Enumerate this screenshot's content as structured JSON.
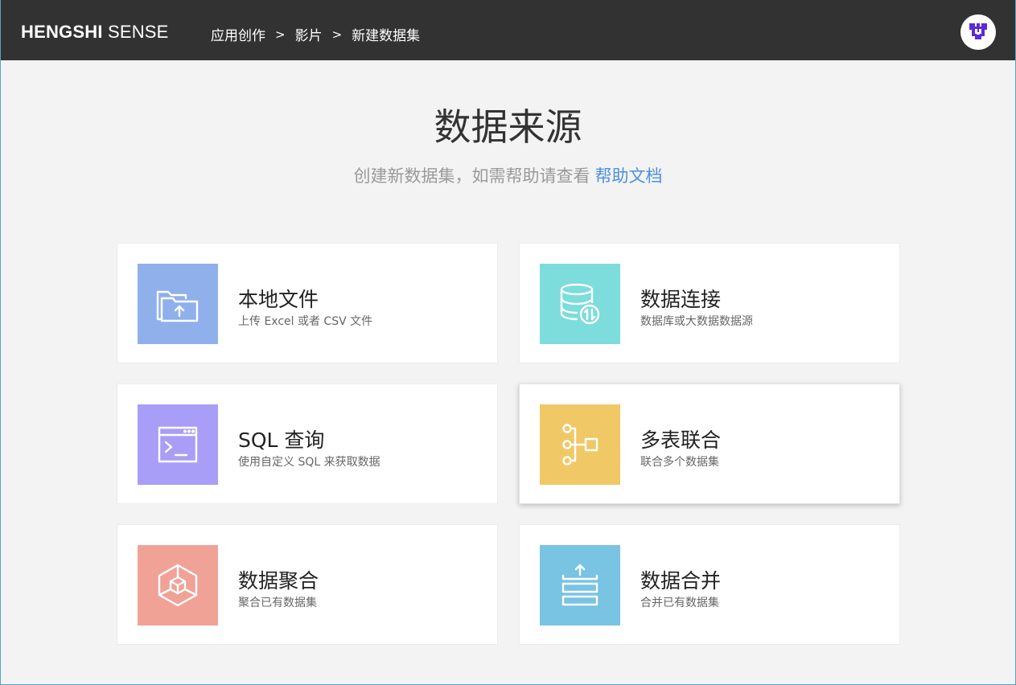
{
  "header": {
    "brand_bold": "HENGSHI",
    "brand_light": "SENSE",
    "breadcrumbs": [
      "应用创作",
      "影片",
      "新建数据集"
    ],
    "separator": ">",
    "avatar_icon": "user-avatar-icon"
  },
  "hero": {
    "title": "数据来源",
    "subtitle": "创建新数据集，如需帮助请查看",
    "help_link": "帮助文档"
  },
  "cards": [
    {
      "title": "本地文件",
      "desc": "上传 Excel 或者 CSV 文件",
      "color": "#8fb0ea",
      "icon": "folder-upload-icon"
    },
    {
      "title": "数据连接",
      "desc": "数据库或大数据数据源",
      "color": "#7ddcdc",
      "icon": "database-sync-icon"
    },
    {
      "title": "SQL 查询",
      "desc": "使用自定义 SQL 来获取数据",
      "color": "#a89ef7",
      "icon": "terminal-window-icon"
    },
    {
      "title": "多表联合",
      "desc": "联合多个数据集",
      "color": "#f0c866",
      "icon": "table-join-icon"
    },
    {
      "title": "数据聚合",
      "desc": "聚合已有数据集",
      "color": "#f0a297",
      "icon": "cube-aggregate-icon"
    },
    {
      "title": "数据合并",
      "desc": "合并已有数据集",
      "color": "#79c3e3",
      "icon": "stack-merge-icon"
    }
  ],
  "colors": {
    "header_bg": "#323232",
    "page_bg": "#f3f3f3",
    "link": "#4a90e2",
    "avatar_logo": "#5b2bd9"
  }
}
